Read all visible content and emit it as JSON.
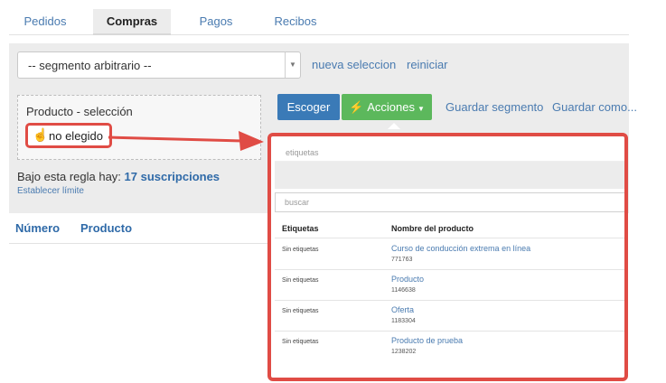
{
  "tabs": [
    {
      "label": "Pedidos",
      "active": false
    },
    {
      "label": "Compras",
      "active": true
    },
    {
      "label": "Pagos",
      "active": false
    },
    {
      "label": "Recibos",
      "active": false
    }
  ],
  "segment_select": {
    "value": "-- segmento arbitrario --"
  },
  "links": {
    "new_selection": "nueva seleccion",
    "reset": "reiniciar",
    "save_segment": "Guardar segmento",
    "save_as": "Guardar como..."
  },
  "product_box": {
    "title": "Producto - selección",
    "chip": "no elegido"
  },
  "buttons": {
    "choose": "Escoger",
    "actions": "Acciones"
  },
  "rule": {
    "prefix": "Bajo esta regla hay:",
    "count_text": "17 suscripciones",
    "set_limit": "Establecer límite"
  },
  "columns": {
    "number": "Número",
    "product": "Producto"
  },
  "popup": {
    "tags_placeholder": "etiquetas",
    "search_placeholder": "buscar",
    "headers": {
      "tags": "Etiquetas",
      "product_name": "Nombre del producto"
    },
    "rows": [
      {
        "tags": "Sin etiquetas",
        "name": "Curso de conducción extrema en línea",
        "id": "771763"
      },
      {
        "tags": "Sin etiquetas",
        "name": "Producto",
        "id": "1146638"
      },
      {
        "tags": "Sin etiquetas",
        "name": "Oferta",
        "id": "1183304"
      },
      {
        "tags": "Sin etiquetas",
        "name": "Producto de prueba",
        "id": "1238202"
      }
    ]
  },
  "colors": {
    "accent_blue": "#3a7ab7",
    "link_blue": "#4a7bb0",
    "action_green": "#5cb85c",
    "highlight_red": "#e04c45",
    "panel_gray": "#ececec"
  },
  "icons": {
    "hand": "pointing-hand-icon",
    "bolt": "lightning-bolt-icon",
    "select_caret": "chevron-down-icon",
    "actions_caret": "caret-down-icon",
    "annotation_arrow": "arrow-right-icon"
  }
}
